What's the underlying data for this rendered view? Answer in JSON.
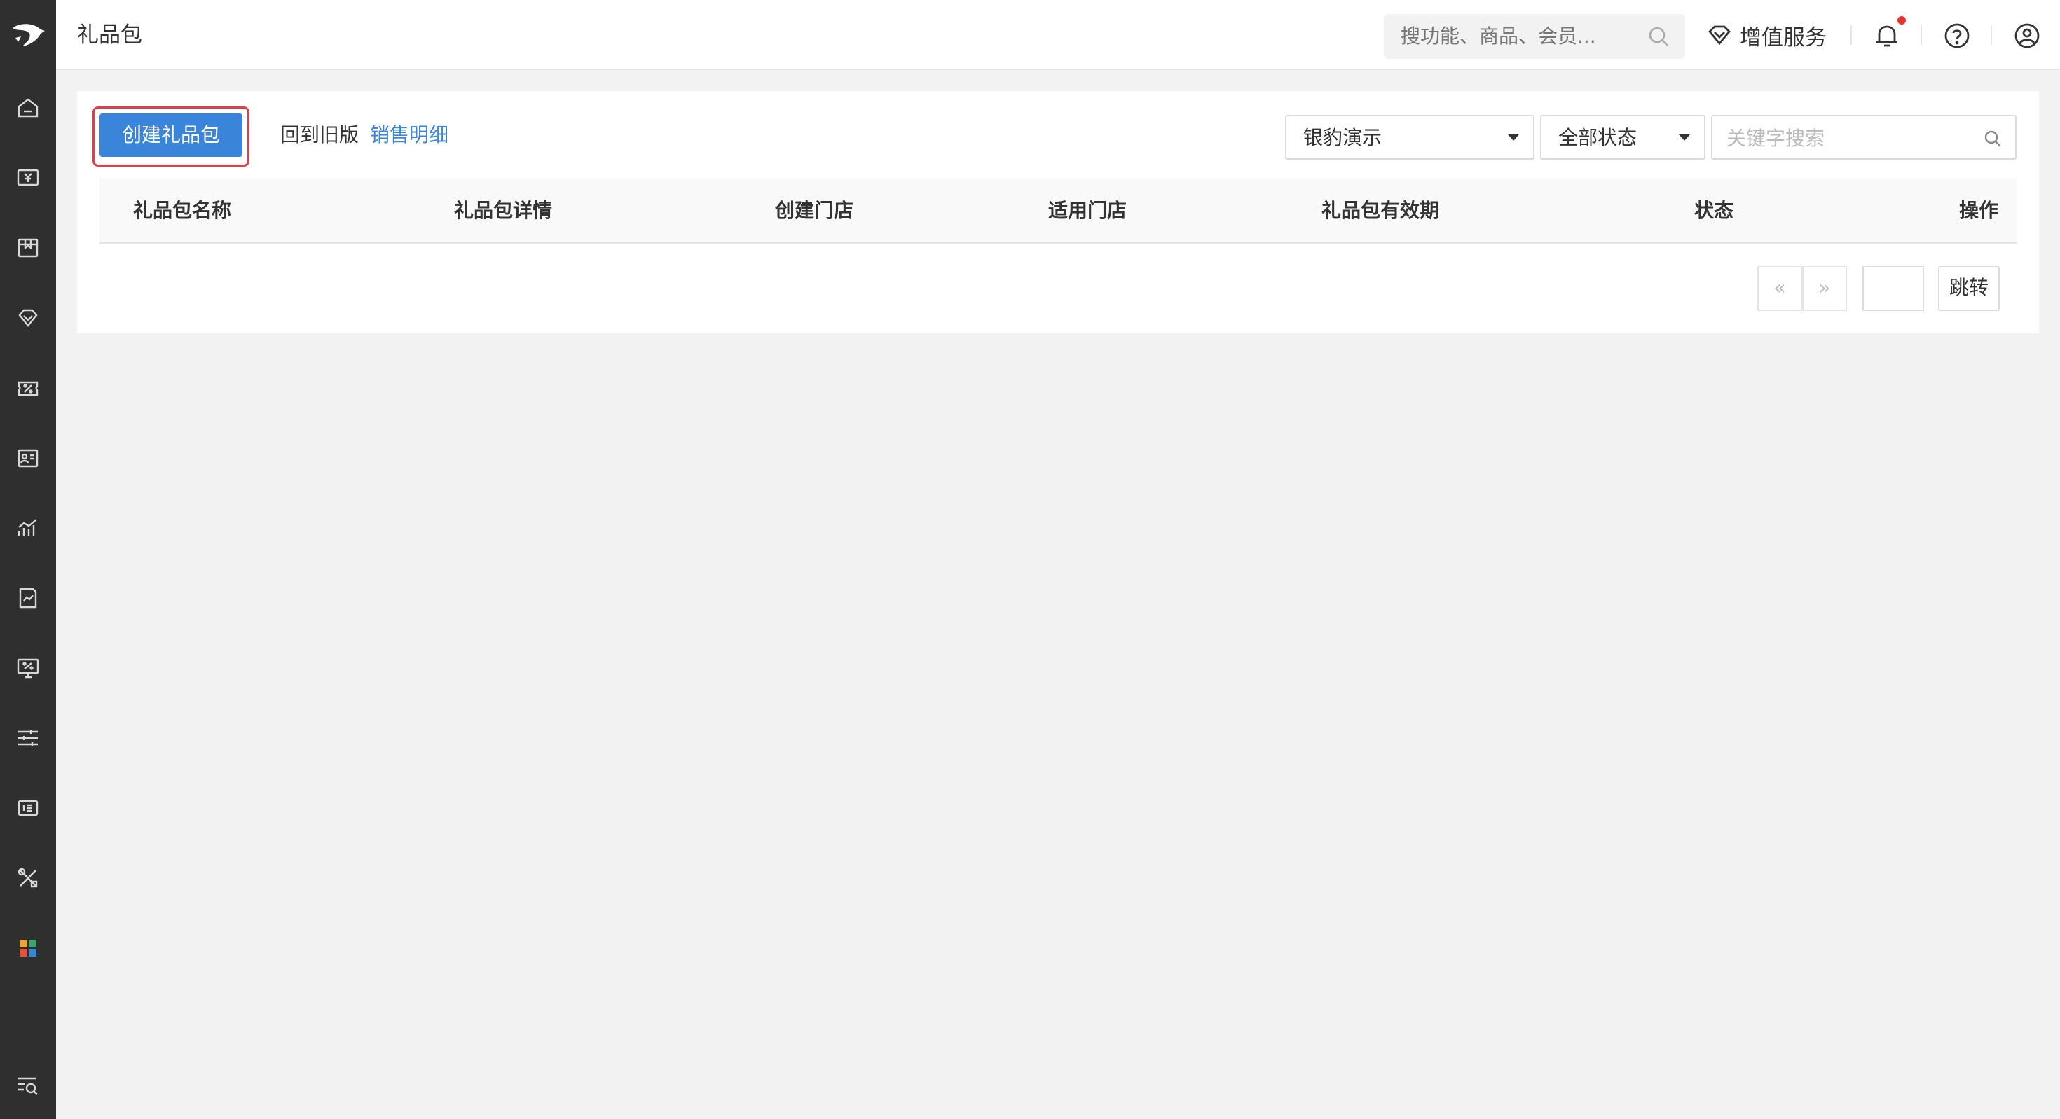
{
  "header": {
    "title": "礼品包",
    "search_placeholder": "搜功能、商品、会员...",
    "value_added_services": "增值服务"
  },
  "sidebar": {
    "items": [
      {
        "icon": "home-icon"
      },
      {
        "icon": "cashier-icon"
      },
      {
        "icon": "goods-box-icon"
      },
      {
        "icon": "member-diamond-icon"
      },
      {
        "icon": "marketing-coupon-icon"
      },
      {
        "icon": "staff-card-icon"
      },
      {
        "icon": "report-chart-icon"
      },
      {
        "icon": "finance-doc-icon"
      },
      {
        "icon": "online-store-icon"
      },
      {
        "icon": "settings-sliders-icon"
      },
      {
        "icon": "devices-icon"
      },
      {
        "icon": "tools-icon"
      },
      {
        "icon": "apps-grid-icon"
      },
      {
        "icon": "menu-search-icon"
      }
    ]
  },
  "toolbar": {
    "create_button": "创建礼品包",
    "back_to_old": "回到旧版",
    "sales_detail": "销售明细",
    "store_select": "银豹演示",
    "status_select": "全部状态",
    "keyword_placeholder": "关键字搜索"
  },
  "table": {
    "columns": [
      "礼品包名称",
      "礼品包详情",
      "创建门店",
      "适用门店",
      "礼品包有效期",
      "状态",
      "操作"
    ],
    "rows": []
  },
  "pagination": {
    "prev": "«",
    "next": "»",
    "page_value": "",
    "jump_label": "跳转"
  },
  "colors": {
    "primary": "#3a85d9",
    "highlight_border": "#e03c4a",
    "sidebar_bg": "#2f2f2f",
    "notification_dot": "#e8332a"
  }
}
